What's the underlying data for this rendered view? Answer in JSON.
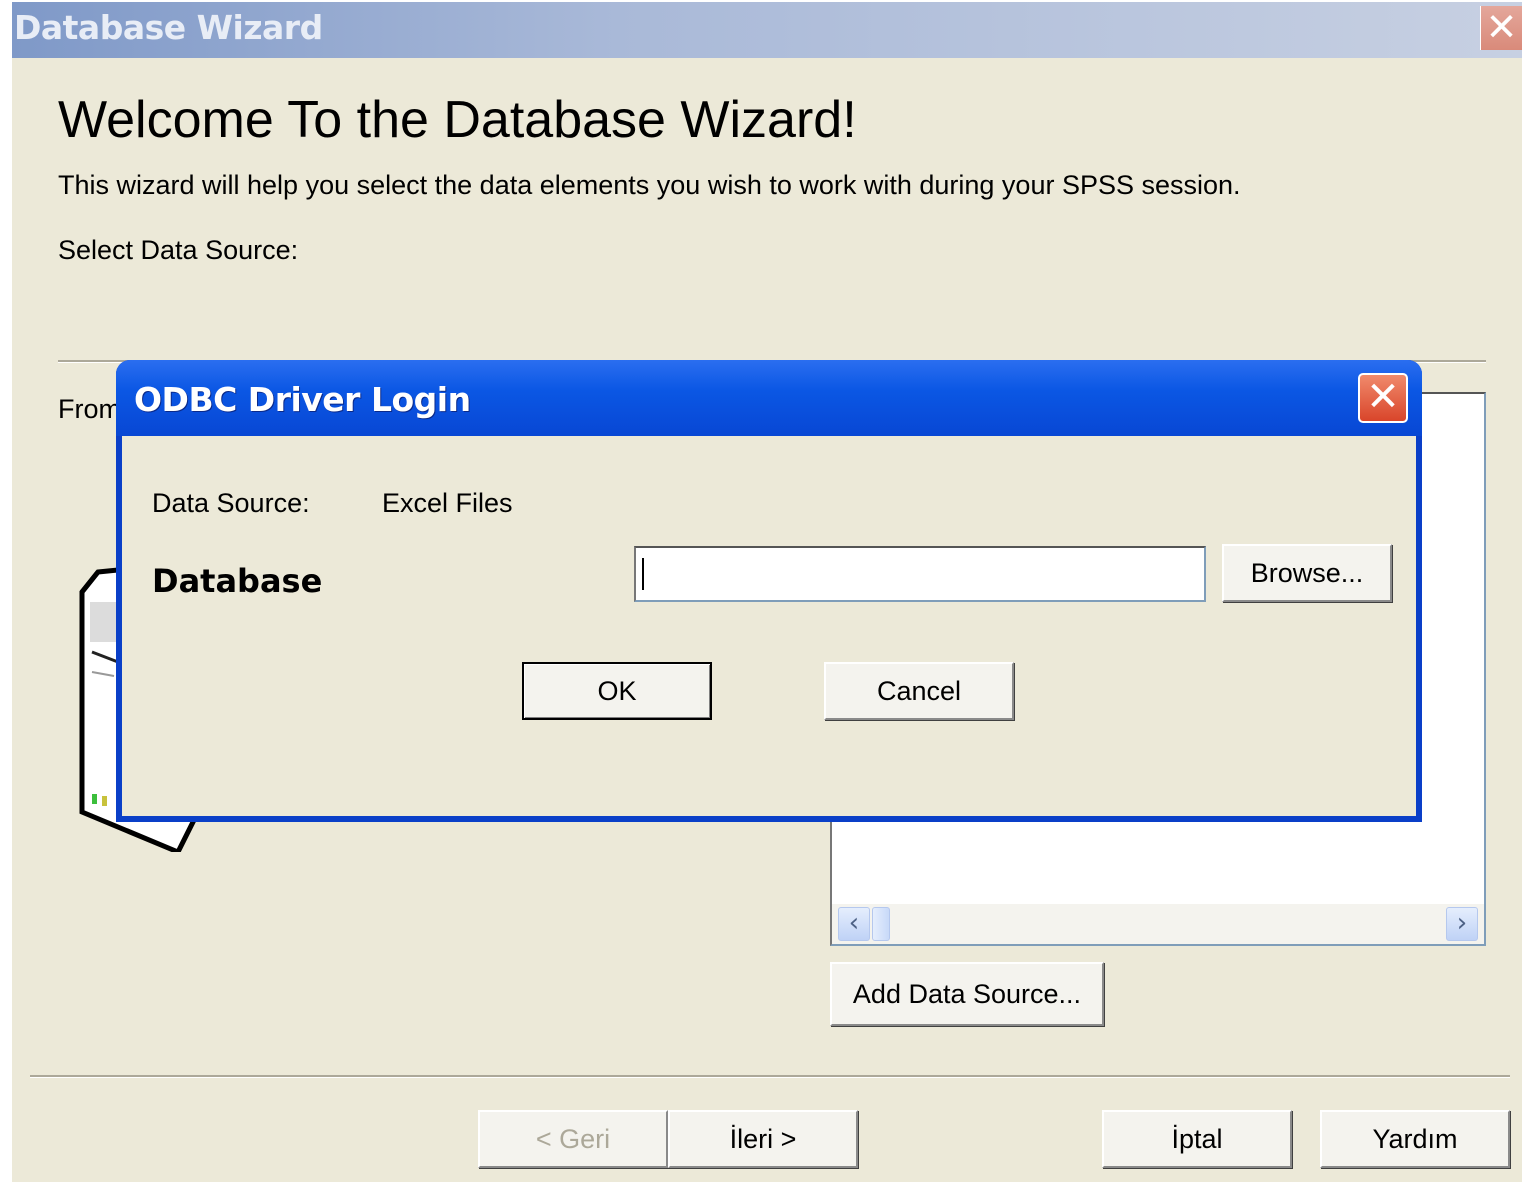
{
  "wizard": {
    "title": "Database Wizard",
    "close_glyph": "✕",
    "heading": "Welcome To the Database Wizard!",
    "description": "This wizard will help you select the data elements you wish to work with during your SPSS session.",
    "select_label": "Select Data Source:",
    "from_label": "From",
    "add_data_source_label": "Add Data Source...",
    "scroll_left_glyph": "‹",
    "scroll_right_glyph": "›",
    "buttons": {
      "back": "< Geri",
      "next": "İleri >",
      "cancel": "İptal",
      "help": "Yardım"
    }
  },
  "odbc_dialog": {
    "title": "ODBC Driver Login",
    "close_glyph": "✕",
    "data_source_label": "Data Source:",
    "data_source_value": "Excel Files",
    "database_label": "Database",
    "database_value": "",
    "browse_label": "Browse...",
    "ok_label": "OK",
    "cancel_label": "Cancel"
  },
  "colors": {
    "dialog_face": "#ece9d8",
    "xp_blue_title": "#0b57e4",
    "close_red": "#d9452a",
    "inactive_title": "#7f99c8"
  },
  "icons": [
    "close-icon",
    "server-icon",
    "scroll-left-arrow-icon",
    "scroll-right-arrow-icon"
  ]
}
